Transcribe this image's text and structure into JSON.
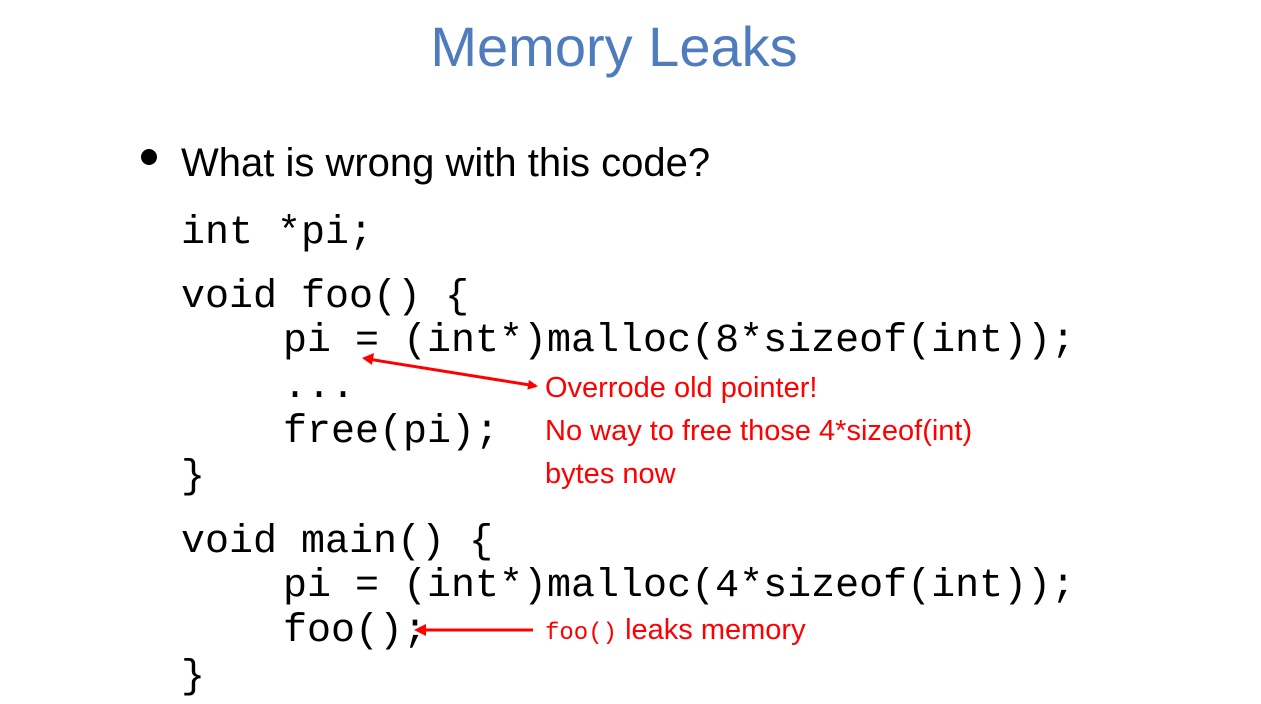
{
  "slide": {
    "title": "Memory Leaks",
    "bullet": "What is wrong with this code?"
  },
  "code": {
    "line1": "int *pi;",
    "line2": "void foo() {",
    "line3": "pi = (int*)malloc(8*sizeof(int));",
    "line4": "...",
    "line5": "free(pi);",
    "line6": "}",
    "line7": "void main() {",
    "line8": "pi = (int*)malloc(4*sizeof(int));",
    "line9": "foo();",
    "line10": "}"
  },
  "annotations": {
    "note1_line1": "Overrode old pointer!",
    "note1_line2": "No way to free those 4*sizeof(int)",
    "note1_line3": "bytes now",
    "note2_code": "foo()",
    "note2_text": "leaks memory",
    "color": "#ff0000"
  },
  "theme": {
    "title_color": "#4f7cbd"
  }
}
